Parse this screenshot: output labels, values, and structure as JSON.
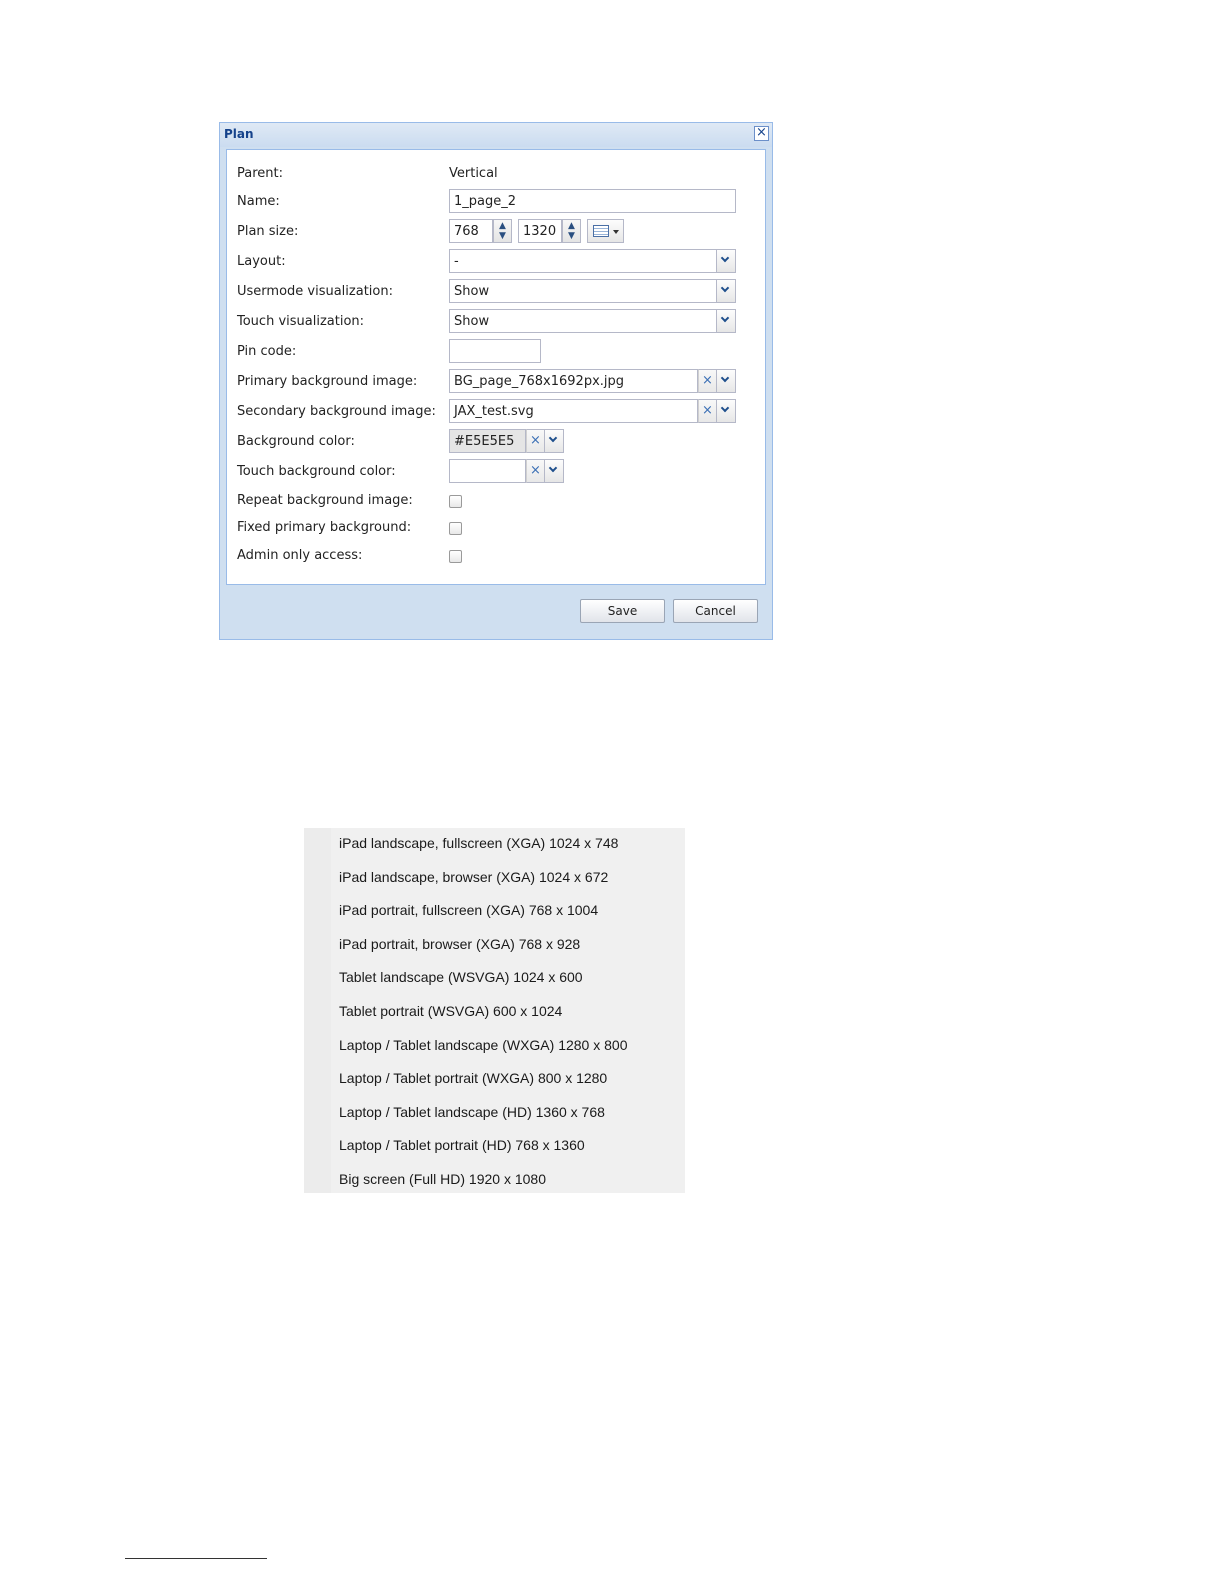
{
  "dialog": {
    "title": "Plan",
    "close_glyph": "×",
    "fields": {
      "parent": {
        "label": "Parent:",
        "value": "Vertical"
      },
      "name": {
        "label": "Name:",
        "value": "1_page_2"
      },
      "plan_size": {
        "label": "Plan size:",
        "width": "768",
        "height": "1320"
      },
      "layout": {
        "label": "Layout:",
        "value": "-"
      },
      "usermode_visualization": {
        "label": "Usermode visualization:",
        "value": "Show"
      },
      "touch_visualization": {
        "label": "Touch visualization:",
        "value": "Show"
      },
      "pin_code": {
        "label": "Pin code:",
        "value": ""
      },
      "primary_background_image": {
        "label": "Primary background image:",
        "value": "BG_page_768x1692px.jpg"
      },
      "secondary_background_image": {
        "label": "Secondary background image:",
        "value": "JAX_test.svg"
      },
      "background_color": {
        "label": "Background color:",
        "value": "#E5E5E5",
        "swatch": "#E5E5E5"
      },
      "touch_background_color": {
        "label": "Touch background color:",
        "value": ""
      },
      "repeat_background_image": {
        "label": "Repeat background image:",
        "checked": false
      },
      "fixed_primary_background": {
        "label": "Fixed primary background:",
        "checked": false
      },
      "admin_only_access": {
        "label": "Admin only access:",
        "checked": false
      }
    },
    "buttons": {
      "save": "Save",
      "cancel": "Cancel"
    },
    "icons": {
      "clear": "×",
      "spin_up": "▲",
      "spin_down": "▼"
    }
  },
  "presets": {
    "items": [
      "iPad landscape, fullscreen (XGA) 1024 x 748",
      "iPad landscape, browser (XGA) 1024 x 672",
      "iPad portrait, fullscreen (XGA) 768 x 1004",
      "iPad portrait, browser (XGA) 768 x 928",
      "Tablet landscape (WSVGA) 1024 x 600",
      "Tablet portrait (WSVGA) 600 x 1024",
      "Laptop / Tablet landscape (WXGA) 1280 x 800",
      "Laptop / Tablet portrait (WXGA) 800 x 1280",
      "Laptop / Tablet landscape (HD) 1360 x 768",
      "Laptop / Tablet portrait (HD) 768 x 1360",
      "Big screen (Full HD) 1920 x 1080"
    ]
  },
  "colors": {
    "title_text": "#15428b",
    "frame": "#cfdff0",
    "border": "#99bbe8"
  }
}
